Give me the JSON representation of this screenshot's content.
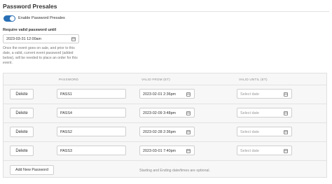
{
  "section": {
    "title": "Password Presales"
  },
  "toggle": {
    "label": "Enable Password Presales",
    "enabled": true,
    "accent_color": "#2a6fb5"
  },
  "require_until": {
    "label": "Require valid password until",
    "value": "2023-03-31 12:00am",
    "icon": "calendar-icon"
  },
  "help_text": "Once the event goes on sale, and prior to this date, a valid, current event password (added below), will be needed to place an order for this event.",
  "table": {
    "headers": [
      "PASSWORD",
      "VALID FROM (ET)",
      "VALID UNTIL (ET)"
    ],
    "delete_label": "Delete",
    "until_placeholder": "Select date",
    "rows": [
      {
        "password": "PASS1",
        "valid_from": "2023-02-01 2:36pm",
        "valid_until": ""
      },
      {
        "password": "PASS4",
        "valid_from": "2023-02-09 3:48pm",
        "valid_until": ""
      },
      {
        "password": "PASS2",
        "valid_from": "2023-02-28 2:36pm",
        "valid_until": ""
      },
      {
        "password": "PASS3",
        "valid_from": "2023-03-01 7:40pm",
        "valid_until": ""
      }
    ],
    "add_button_label": "Add New Password",
    "footer_note": "Starting and Ending date/times are optional."
  }
}
